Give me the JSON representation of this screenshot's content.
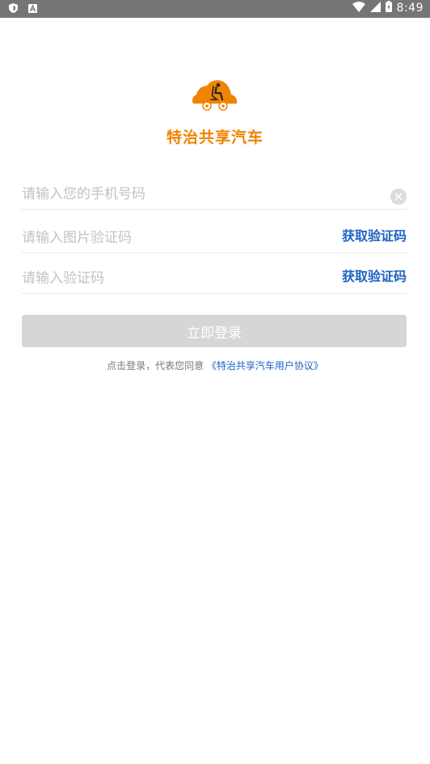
{
  "status_bar": {
    "left_icons": [
      "shield-icon",
      "android-a-icon"
    ],
    "right_icons": [
      "wifi-icon",
      "signal-icon",
      "battery-icon"
    ],
    "time": "8:49"
  },
  "brand": {
    "logo_icon": "car-seat-logo-icon",
    "app_name": "特治共享汽车",
    "accent_color": "#f08300"
  },
  "form": {
    "phone": {
      "value": "",
      "placeholder": "请输入您的手机号码"
    },
    "image_captcha": {
      "value": "",
      "placeholder": "请输入图片验证码",
      "action_label": "获取验证码"
    },
    "sms_code": {
      "value": "",
      "placeholder": "请输入验证码",
      "action_label": "获取验证码"
    },
    "login_label": "立即登录"
  },
  "agreement": {
    "prefix": "点击登录，代表您同意",
    "link_text": "《特治共享汽车用户协议》",
    "link_color": "#1e63c4"
  }
}
